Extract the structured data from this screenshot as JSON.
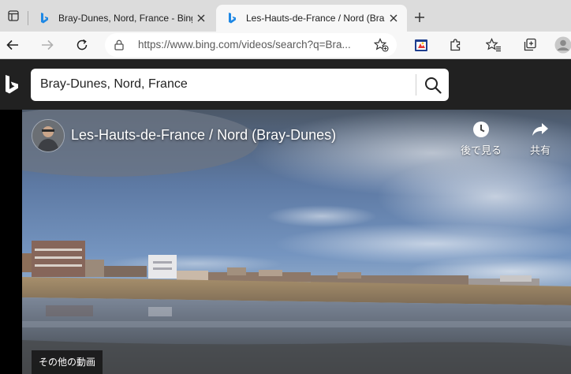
{
  "browser": {
    "tabs": [
      {
        "title": "Bray-Dunes, Nord, France - Bing",
        "active": false,
        "favicon": "bing-icon"
      },
      {
        "title": "Les-Hauts-de-France / Nord (Bra",
        "active": true,
        "favicon": "bing-icon"
      }
    ],
    "address_url": "https://www.bing.com/videos/search?q=Bra..."
  },
  "bing": {
    "search_value": "Bray-Dunes, Nord, France",
    "brand_color": "#008373"
  },
  "video": {
    "title": "Les-Hauts-de-France / Nord (Bray-Dunes)",
    "watch_later_label": "後で見る",
    "share_label": "共有",
    "more_videos_label": "その他の動画"
  }
}
